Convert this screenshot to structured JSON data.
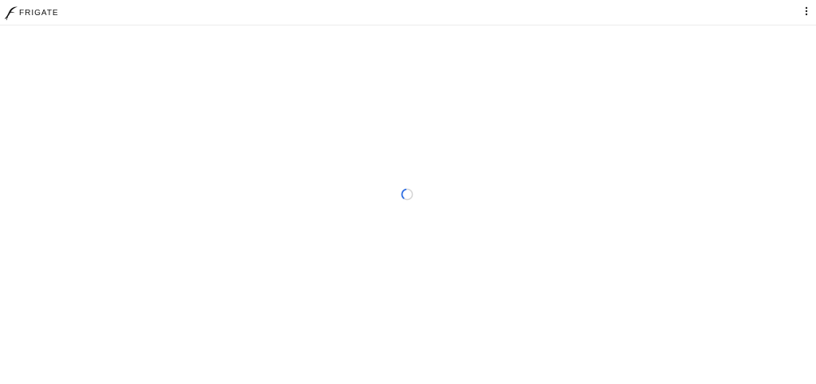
{
  "header": {
    "brand_name": "FRIGATE",
    "logo_icon": "frigate-bird-icon",
    "menu_icon": "more-vertical-icon"
  },
  "main": {
    "loading_indicator": "spinner-icon"
  },
  "colors": {
    "background": "#ffffff",
    "header_border": "#ececec",
    "brand_text": "#111111",
    "spinner_accent": "#2f6fe4",
    "spinner_track": "#d6d6d6"
  }
}
